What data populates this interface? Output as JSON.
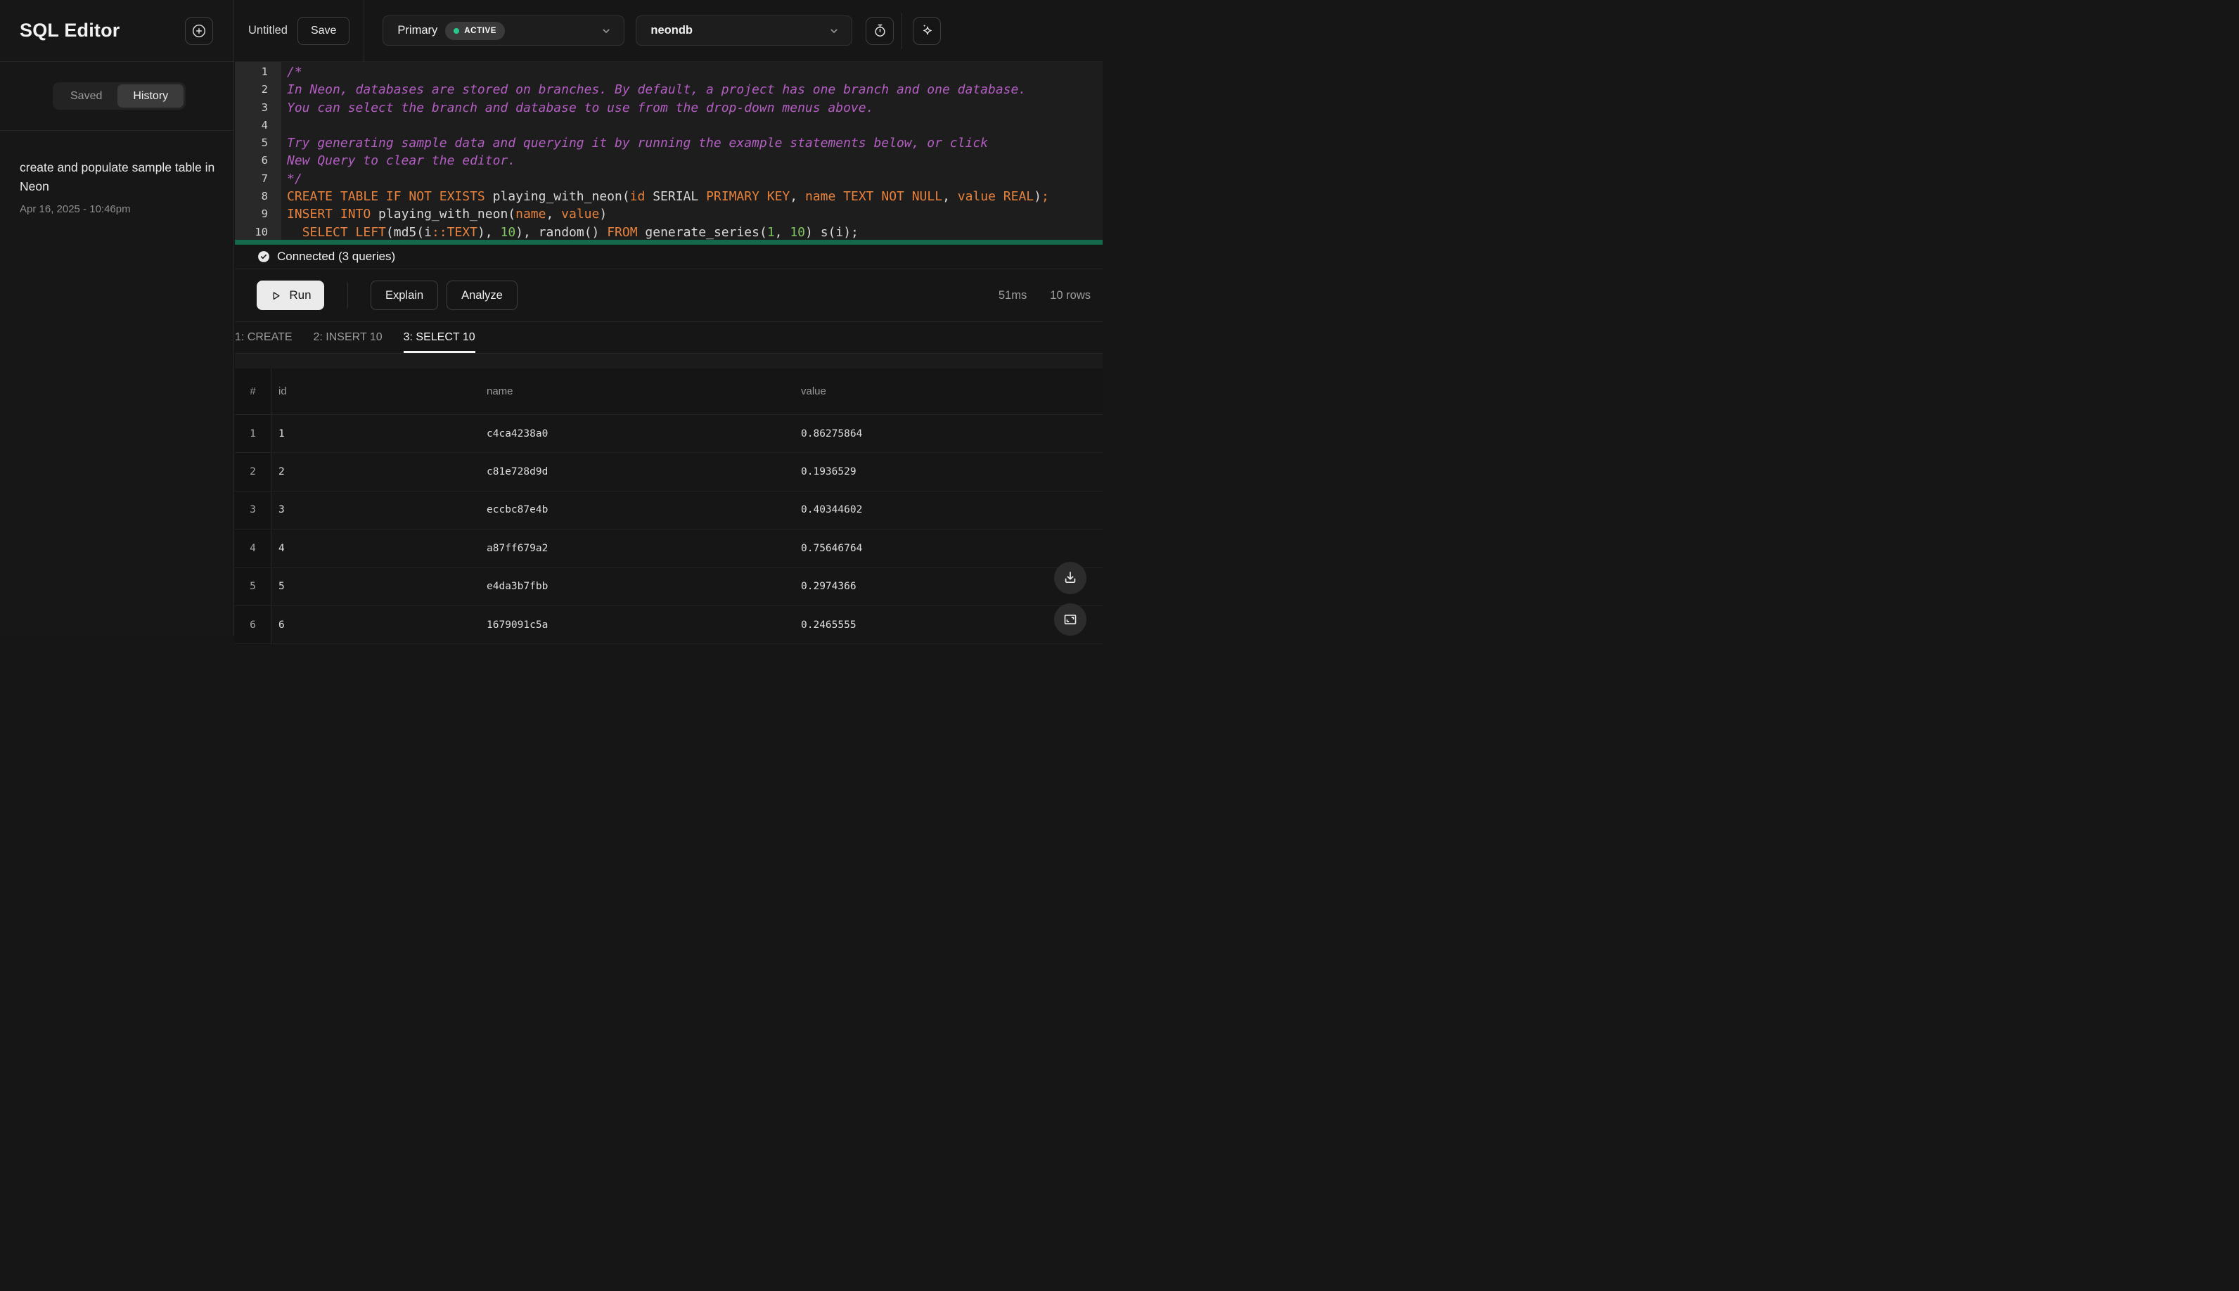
{
  "colors": {
    "accent_green_dot": "#2ac98e",
    "query_highlight_bar": "#15684a",
    "code_keyword": "#e8823c",
    "code_comment": "#b45ec4",
    "code_number": "#7ec462",
    "code_plain": "#d9d9d9"
  },
  "sidebar": {
    "title": "SQL Editor",
    "tabs": {
      "saved": "Saved",
      "history": "History"
    },
    "history_item": {
      "title": "create and populate sample table in Neon",
      "date": "Apr 16, 2025 - 10:46pm"
    }
  },
  "topbar": {
    "query_name": "Untitled",
    "save_label": "Save",
    "branch_select": {
      "value": "Primary",
      "badge": "ACTIVE"
    },
    "database_select": {
      "value": "neondb"
    }
  },
  "editor": {
    "lines": [
      {
        "num": 1,
        "tokens": [
          {
            "c": "c",
            "t": "/*"
          }
        ]
      },
      {
        "num": 2,
        "tokens": [
          {
            "c": "c",
            "t": "In Neon, databases are stored on branches. By default, a project has one branch and one database."
          }
        ]
      },
      {
        "num": 3,
        "tokens": [
          {
            "c": "c",
            "t": "You can select the branch and database to use from the drop-down menus above."
          }
        ]
      },
      {
        "num": 4,
        "tokens": []
      },
      {
        "num": 5,
        "tokens": [
          {
            "c": "c",
            "t": "Try generating sample data and querying it by running the example statements below, or click"
          }
        ]
      },
      {
        "num": 6,
        "tokens": [
          {
            "c": "c",
            "t": "New Query to clear the editor."
          }
        ]
      },
      {
        "num": 7,
        "tokens": [
          {
            "c": "c",
            "t": "*/"
          }
        ]
      },
      {
        "num": 8,
        "tokens": [
          {
            "c": "k",
            "t": "CREATE TABLE IF NOT EXISTS"
          },
          {
            "c": "p",
            "t": " playing_with_neon("
          },
          {
            "c": "k",
            "t": "id"
          },
          {
            "c": "p",
            "t": " SERIAL "
          },
          {
            "c": "k",
            "t": "PRIMARY KEY"
          },
          {
            "c": "p",
            "t": ", "
          },
          {
            "c": "k",
            "t": "name"
          },
          {
            "c": "p",
            "t": " "
          },
          {
            "c": "k",
            "t": "TEXT NOT NULL"
          },
          {
            "c": "p",
            "t": ", "
          },
          {
            "c": "k",
            "t": "value"
          },
          {
            "c": "p",
            "t": " "
          },
          {
            "c": "k",
            "t": "REAL"
          },
          {
            "c": "p",
            "t": ")"
          },
          {
            "c": "k",
            "t": ";"
          }
        ]
      },
      {
        "num": 9,
        "tokens": [
          {
            "c": "k",
            "t": "INSERT INTO"
          },
          {
            "c": "p",
            "t": " playing_with_neon("
          },
          {
            "c": "k",
            "t": "name"
          },
          {
            "c": "p",
            "t": ", "
          },
          {
            "c": "k",
            "t": "value"
          },
          {
            "c": "p",
            "t": ")"
          }
        ]
      },
      {
        "num": 10,
        "tokens": [
          {
            "c": "p",
            "t": "  "
          },
          {
            "c": "k",
            "t": "SELECT LEFT"
          },
          {
            "c": "p",
            "t": "(md5(i"
          },
          {
            "c": "k",
            "t": "::TEXT"
          },
          {
            "c": "p",
            "t": "), "
          },
          {
            "c": "n",
            "t": "10"
          },
          {
            "c": "p",
            "t": "), random() "
          },
          {
            "c": "k",
            "t": "FROM"
          },
          {
            "c": "p",
            "t": " generate_series("
          },
          {
            "c": "n",
            "t": "1"
          },
          {
            "c": "p",
            "t": ", "
          },
          {
            "c": "n",
            "t": "10"
          },
          {
            "c": "p",
            "t": ") s(i);"
          }
        ]
      }
    ]
  },
  "status": {
    "connected": "Connected (3 queries)"
  },
  "actions": {
    "run": "Run",
    "explain": "Explain",
    "analyze": "Analyze",
    "duration": "51ms",
    "rows": "10 rows"
  },
  "results": {
    "tabs": [
      {
        "label": "1: CREATE",
        "active": false
      },
      {
        "label": "2: INSERT 10",
        "active": false
      },
      {
        "label": "3: SELECT 10",
        "active": true
      }
    ],
    "table": {
      "columns": [
        "#",
        "id",
        "name",
        "value"
      ],
      "rows": [
        [
          "1",
          "1",
          "c4ca4238a0",
          "0.86275864"
        ],
        [
          "2",
          "2",
          "c81e728d9d",
          "0.1936529"
        ],
        [
          "3",
          "3",
          "eccbc87e4b",
          "0.40344602"
        ],
        [
          "4",
          "4",
          "a87ff679a2",
          "0.75646764"
        ],
        [
          "5",
          "5",
          "e4da3b7fbb",
          "0.2974366"
        ],
        [
          "6",
          "6",
          "1679091c5a",
          "0.2465555"
        ]
      ]
    }
  }
}
